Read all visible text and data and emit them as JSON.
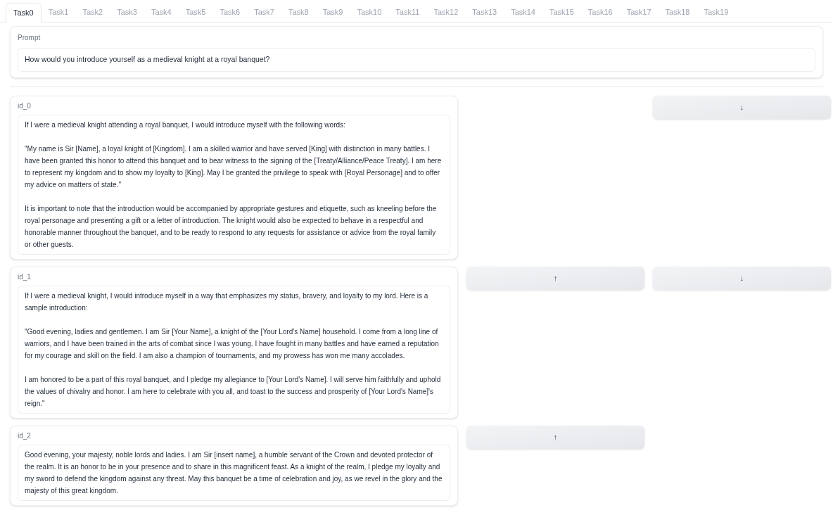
{
  "tabs": [
    {
      "label": "Task0",
      "selected": true
    },
    {
      "label": "Task1",
      "selected": false
    },
    {
      "label": "Task2",
      "selected": false
    },
    {
      "label": "Task3",
      "selected": false
    },
    {
      "label": "Task4",
      "selected": false
    },
    {
      "label": "Task5",
      "selected": false
    },
    {
      "label": "Task6",
      "selected": false
    },
    {
      "label": "Task7",
      "selected": false
    },
    {
      "label": "Task8",
      "selected": false
    },
    {
      "label": "Task9",
      "selected": false
    },
    {
      "label": "Task10",
      "selected": false
    },
    {
      "label": "Task11",
      "selected": false
    },
    {
      "label": "Task12",
      "selected": false
    },
    {
      "label": "Task13",
      "selected": false
    },
    {
      "label": "Task14",
      "selected": false
    },
    {
      "label": "Task15",
      "selected": false
    },
    {
      "label": "Task16",
      "selected": false
    },
    {
      "label": "Task17",
      "selected": false
    },
    {
      "label": "Task18",
      "selected": false
    },
    {
      "label": "Task19",
      "selected": false
    }
  ],
  "prompt": {
    "label": "Prompt",
    "value": "How would you introduce yourself as a medieval knight at a royal banquet?"
  },
  "responses": [
    {
      "label": "id_0",
      "text": "If I were a medieval knight attending a royal banquet, I would introduce myself with the following words:\n\n\"My name is Sir [Name], a loyal knight of [Kingdom]. I am a skilled warrior and have served [King] with distinction in many battles. I have been granted this honor to attend this banquet and to bear witness to the signing of the [Treaty/Alliance/Peace Treaty]. I am here to represent my kingdom and to show my loyalty to [King]. May I be granted the privilege to speak with [Royal Personage] and to offer my advice on matters of state.\"\n\nIt is important to note that the introduction would be accompanied by appropriate gestures and etiquette, such as kneeling before the royal personage and presenting a gift or a letter of introduction. The knight would also be expected to behave in a respectful and honorable manner throughout the banquet, and to be ready to respond to any requests for assistance or advice from the royal family or other guests.",
      "buttons": [
        {
          "kind": "down",
          "label": "↓"
        }
      ]
    },
    {
      "label": "id_1",
      "text": "If I were a medieval knight, I would introduce myself in a way that emphasizes my status, bravery, and loyalty to my lord. Here is a sample introduction:\n\n\"Good evening, ladies and gentlemen. I am Sir [Your Name], a knight of the [Your Lord's Name] household. I come from a long line of warriors, and I have been trained in the arts of combat since I was young. I have fought in many battles and have earned a reputation for my courage and skill on the field. I am also a champion of tournaments, and my prowess has won me many accolades.\n\nI am honored to be a part of this royal banquet, and I pledge my allegiance to [Your Lord's Name]. I will serve him faithfully and uphold the values of chivalry and honor. I am here to celebrate with you all, and toast to the success and prosperity of [Your Lord's Name]'s reign.\"",
      "buttons": [
        {
          "kind": "up",
          "label": "↑"
        },
        {
          "kind": "down",
          "label": "↓"
        }
      ]
    },
    {
      "label": "id_2",
      "text": "Good evening, your majesty, noble lords and ladies. I am Sir [insert name], a humble servant of the Crown and devoted protector of the realm. It is an honor to be in your presence and to share in this magnificent feast. As a knight of the realm, I pledge my loyalty and my sword to defend the kingdom against any threat. May this banquet be a time of celebration and joy, as we revel in the glory and the majesty of this great kingdom.",
      "buttons": [
        {
          "kind": "up",
          "label": "↑"
        }
      ]
    }
  ]
}
